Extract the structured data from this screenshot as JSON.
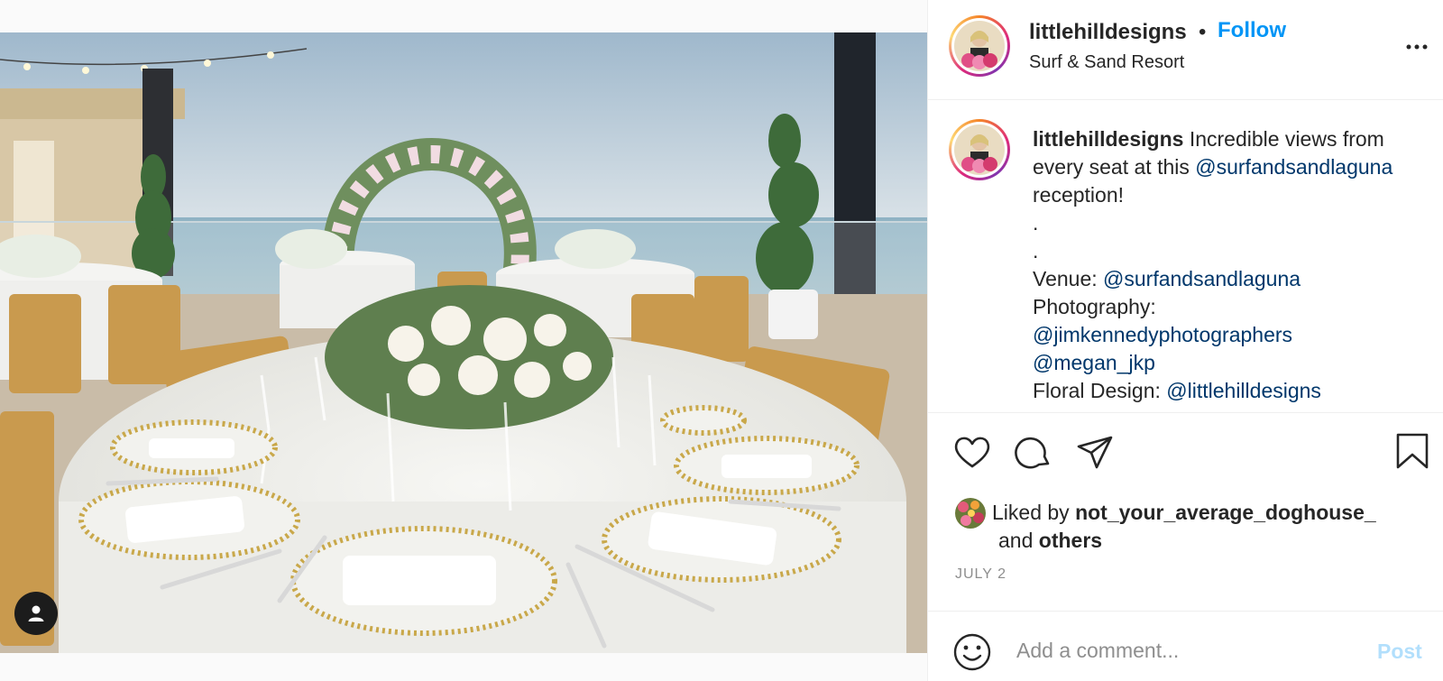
{
  "post": {
    "username": "littlehilldesigns",
    "separator": "•",
    "follow_label": "Follow",
    "location": "Surf & Sand Resort",
    "more_icon": "more-horizontal-icon"
  },
  "caption": {
    "username": "littlehilldesigns",
    "text_intro": "Incredible views from every seat at this ",
    "mention_resort": "@surfandsandlaguna",
    "text_after": " reception!",
    "dot1": ".",
    "dot2": ".",
    "venue_label": "Venue: ",
    "venue_mention": "@surfandsandlaguna",
    "photo_label": "Photography:",
    "photo_mention1": "@jimkennedyphotographers",
    "photo_mention2": "@megan_jkp",
    "floral_label": "Floral Design: ",
    "floral_mention": "@littlehilldesigns"
  },
  "actions": {
    "like_icon": "heart-icon",
    "comment_icon": "comment-bubble-icon",
    "share_icon": "paper-plane-icon",
    "save_icon": "bookmark-icon"
  },
  "likes": {
    "prefix": "Liked by ",
    "user": "not_your_average_doghouse_",
    "and": "and ",
    "others": "others"
  },
  "date": "JULY 2",
  "comment": {
    "placeholder": "Add a comment...",
    "post_label": "Post",
    "emoji_icon": "smiley-icon"
  },
  "media": {
    "tag_icon": "user-tag-icon"
  },
  "colors": {
    "accent": "#0095f6",
    "mention": "#00376b",
    "muted": "#8e8e8e",
    "post_disabled": "#b2dffc"
  }
}
